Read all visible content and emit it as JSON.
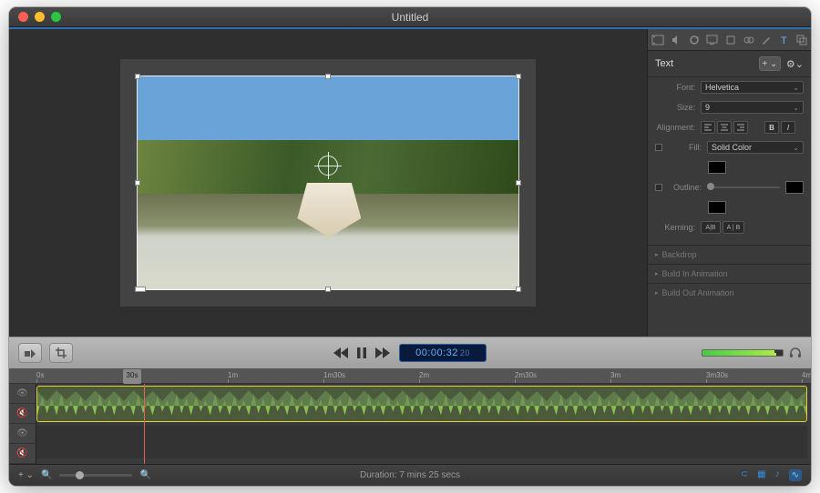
{
  "window": {
    "title": "Untitled"
  },
  "inspector": {
    "heading": "Text",
    "font_label": "Font:",
    "font_value": "Helvetica",
    "size_label": "Size:",
    "size_value": "9",
    "align_label": "Alignment:",
    "fill_label": "Fill:",
    "fill_value": "Solid Color",
    "outline_label": "Outline:",
    "kerning_label": "Kerning:",
    "backdrop": "Backdrop",
    "build_in": "Build In Animation",
    "build_out": "Build Out Animation"
  },
  "playback": {
    "timecode": "00:00:32",
    "frames": "20"
  },
  "ruler": {
    "marks": [
      "0s",
      "30s",
      "1m",
      "1m30s",
      "2m",
      "2m30s",
      "3m",
      "3m30s",
      "4m"
    ]
  },
  "footer": {
    "duration": "Duration: 7 mins 25 secs"
  }
}
